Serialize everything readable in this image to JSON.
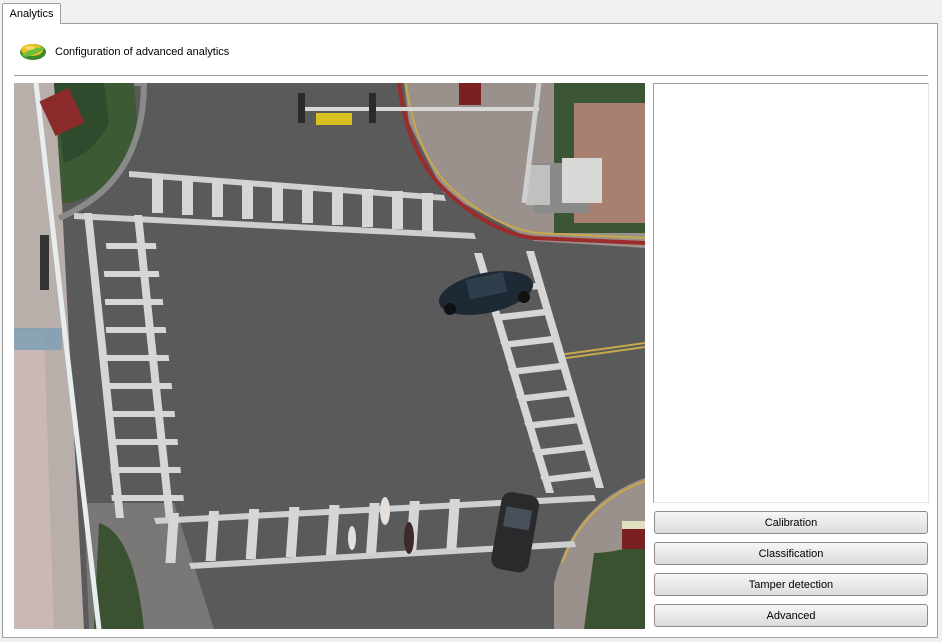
{
  "tabs": [
    {
      "label": "Analytics",
      "active": true
    }
  ],
  "header": {
    "title": "Configuration of advanced analytics",
    "icon": "analytics-logo-icon"
  },
  "video": {
    "description_icon": "camera-feed",
    "sign_top_left": "",
    "street_sign": ""
  },
  "buttons": {
    "calibration": "Calibration",
    "classification": "Classification",
    "tamper_detection": "Tamper detection",
    "advanced": "Advanced"
  },
  "colors": {
    "panel_bg": "#ffffff",
    "window_bg": "#f0f0f0",
    "border": "#a0a0a0",
    "road": "#5b5b5c",
    "crosswalk": "#d9d9d9",
    "curb_red": "#9c2b2b",
    "lane_yellow": "#c8a94a"
  }
}
